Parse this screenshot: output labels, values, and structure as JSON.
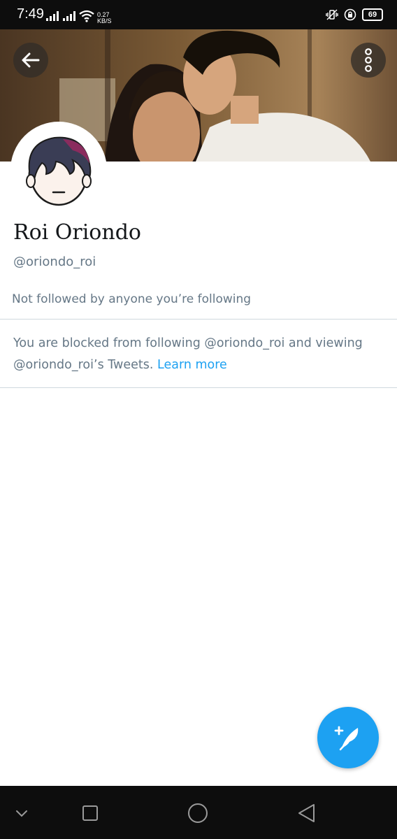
{
  "status_bar": {
    "time": "7:49",
    "speed_value": "0.27",
    "speed_unit": "KB/S",
    "battery": "69"
  },
  "profile": {
    "display_name": "Roi Oriondo",
    "handle": "@oriondo_roi",
    "followed_by_text": "Not followed by anyone you’re following"
  },
  "blocked": {
    "message": "You are blocked from following @oriondo_roi and viewing @oriondo_roi’s Tweets.",
    "learn_more": "Learn more"
  },
  "colors": {
    "accent": "#1da1f2",
    "secondary_text": "#657786",
    "status_bar": "#0d0d0d"
  },
  "icons": {
    "back": "back-arrow-icon",
    "more": "more-vertical-icon",
    "compose": "compose-tweet-icon",
    "nav": [
      "chevron-down-icon",
      "recent-apps-icon",
      "home-circle-icon",
      "back-triangle-icon"
    ]
  }
}
